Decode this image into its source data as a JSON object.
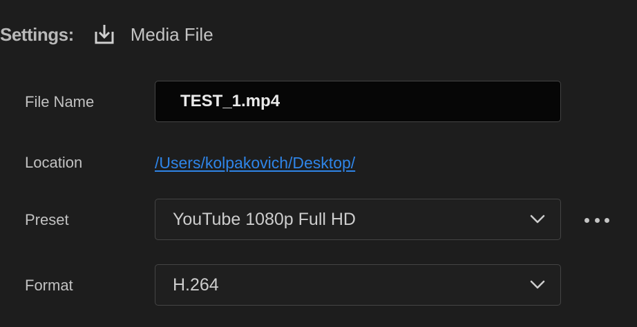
{
  "header": {
    "label": "Settings:",
    "icon": "download-tray-icon",
    "title": "Media File"
  },
  "fields": {
    "file_name": {
      "label": "File Name",
      "value": "TEST_1.mp4"
    },
    "location": {
      "label": "Location",
      "value": "/Users/kolpakovich/Desktop/"
    },
    "preset": {
      "label": "Preset",
      "value": "YouTube 1080p Full HD",
      "more_icon": "more-horizontal-icon"
    },
    "format": {
      "label": "Format",
      "value": "H.264"
    }
  },
  "colors": {
    "background": "#1d1d1d",
    "link": "#2f85e8",
    "input_background": "#060606",
    "border": "#454545"
  }
}
